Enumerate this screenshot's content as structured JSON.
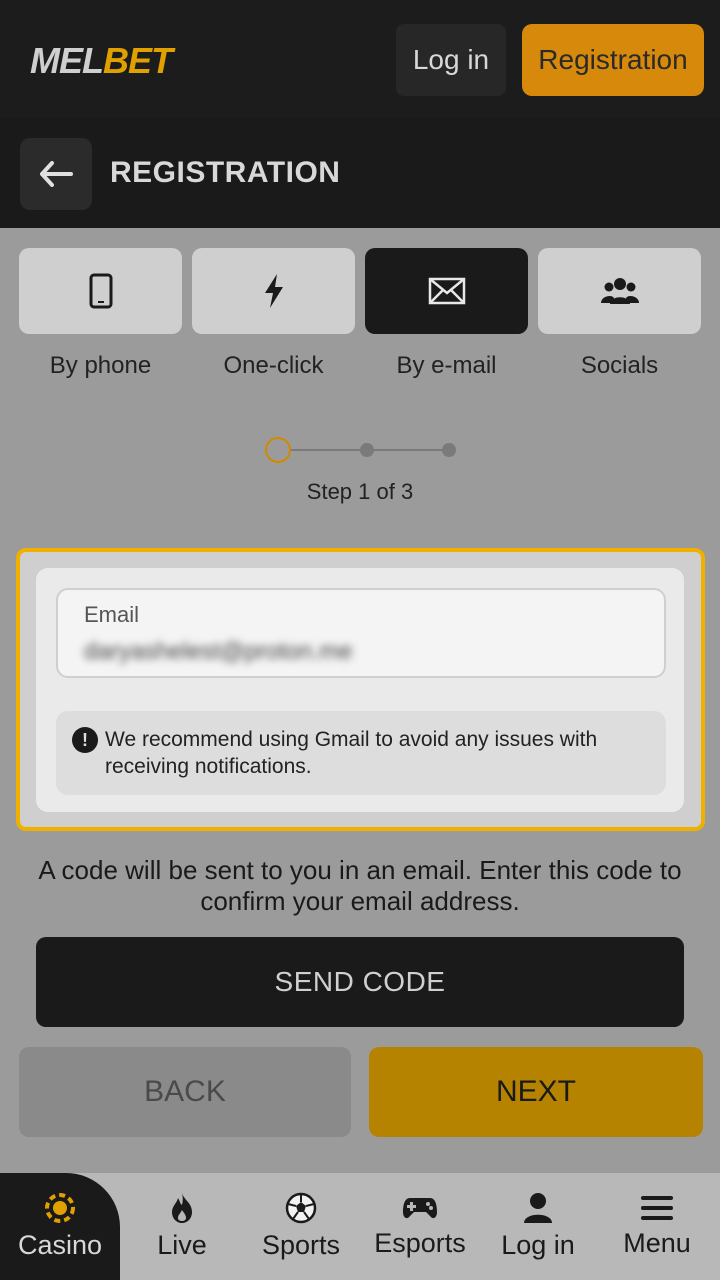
{
  "header": {
    "logo_part1": "MEL",
    "logo_part2": "BET",
    "login_label": "Log in",
    "register_label": "Registration"
  },
  "titlebar": {
    "title": "REGISTRATION"
  },
  "tabs": [
    {
      "label": "By phone",
      "icon": "phone-icon",
      "active": false
    },
    {
      "label": "One-click",
      "icon": "lightning-icon",
      "active": false
    },
    {
      "label": "By e-mail",
      "icon": "envelope-icon",
      "active": true
    },
    {
      "label": "Socials",
      "icon": "users-icon",
      "active": false
    }
  ],
  "stepper": {
    "current": 1,
    "total": 3,
    "text": "Step 1 of 3"
  },
  "form": {
    "email_label": "Email",
    "email_value": "daryashelest@proton.me",
    "notice": "We recommend using Gmail to avoid any issues with receiving notifications."
  },
  "info": "A code will be sent to you in an email. Enter this code to confirm your email address.",
  "buttons": {
    "send_code": "SEND CODE",
    "back": "BACK",
    "next": "NEXT"
  },
  "bottom_nav": [
    {
      "label": "Casino",
      "icon": "casino-chip-icon",
      "active": true
    },
    {
      "label": "Live",
      "icon": "flame-icon",
      "active": false
    },
    {
      "label": "Sports",
      "icon": "soccer-ball-icon",
      "active": false
    },
    {
      "label": "Esports",
      "icon": "gamepad-icon",
      "active": false
    },
    {
      "label": "Log in",
      "icon": "user-icon",
      "active": false
    },
    {
      "label": "Menu",
      "icon": "hamburger-menu-icon",
      "active": false
    }
  ],
  "colors": {
    "accent": "#e0a000",
    "register_button": "#d6890a",
    "next_button": "#b58300",
    "highlight_outline": "#f0b000"
  }
}
